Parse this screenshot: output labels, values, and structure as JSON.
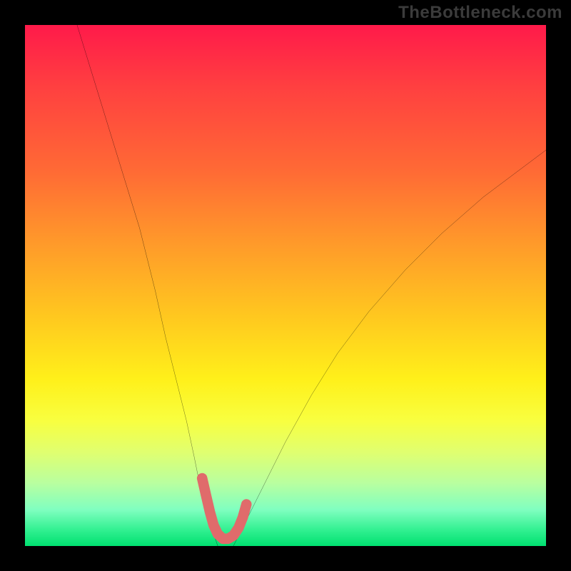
{
  "watermark": "TheBottleneck.com",
  "chart_data": {
    "type": "line",
    "title": "",
    "xlabel": "",
    "ylabel": "",
    "xlim": [
      0,
      100
    ],
    "ylim": [
      0,
      100
    ],
    "grid": false,
    "legend": false,
    "background_gradient": {
      "orientation": "vertical",
      "stops": [
        {
          "pos": 0.0,
          "color": "#ff1a4a"
        },
        {
          "pos": 0.12,
          "color": "#ff4040"
        },
        {
          "pos": 0.28,
          "color": "#ff6a35"
        },
        {
          "pos": 0.42,
          "color": "#ff9a2a"
        },
        {
          "pos": 0.56,
          "color": "#ffc81f"
        },
        {
          "pos": 0.68,
          "color": "#fff01a"
        },
        {
          "pos": 0.76,
          "color": "#f8ff40"
        },
        {
          "pos": 0.82,
          "color": "#e0ff70"
        },
        {
          "pos": 0.88,
          "color": "#b8ffa0"
        },
        {
          "pos": 0.93,
          "color": "#80ffc0"
        },
        {
          "pos": 0.97,
          "color": "#30f090"
        },
        {
          "pos": 1.0,
          "color": "#00e070"
        }
      ]
    },
    "series": [
      {
        "name": "left-branch",
        "color": "#000000",
        "type": "line",
        "x": [
          10,
          14,
          18,
          22,
          25,
          27,
          29,
          31,
          32.5,
          33.5,
          34.5,
          35.2,
          36.0,
          36.5,
          37.0
        ],
        "y": [
          100,
          87,
          74,
          61,
          49,
          40,
          32,
          24,
          17,
          12,
          8,
          5,
          3,
          1.5,
          0
        ]
      },
      {
        "name": "right-branch",
        "color": "#000000",
        "type": "line",
        "x": [
          40.0,
          41.0,
          43.0,
          46.0,
          50.0,
          55.0,
          60.0,
          66.0,
          73.0,
          80.0,
          88.0,
          96.0,
          100.0
        ],
        "y": [
          0,
          2,
          6,
          12,
          20,
          29,
          37,
          45,
          53,
          60,
          67,
          73,
          76
        ]
      },
      {
        "name": "highlight-minimum",
        "color": "#e06b6b",
        "type": "line",
        "stroke_width_px": 14,
        "linecap": "round",
        "x": [
          34.0,
          34.8,
          35.5,
          36.2,
          37.0,
          38.0,
          39.0,
          40.0,
          41.0,
          41.8,
          42.5
        ],
        "y": [
          13.0,
          9.5,
          6.5,
          4.0,
          2.3,
          1.4,
          1.4,
          2.0,
          3.5,
          5.5,
          8.0
        ]
      }
    ],
    "annotations": []
  }
}
